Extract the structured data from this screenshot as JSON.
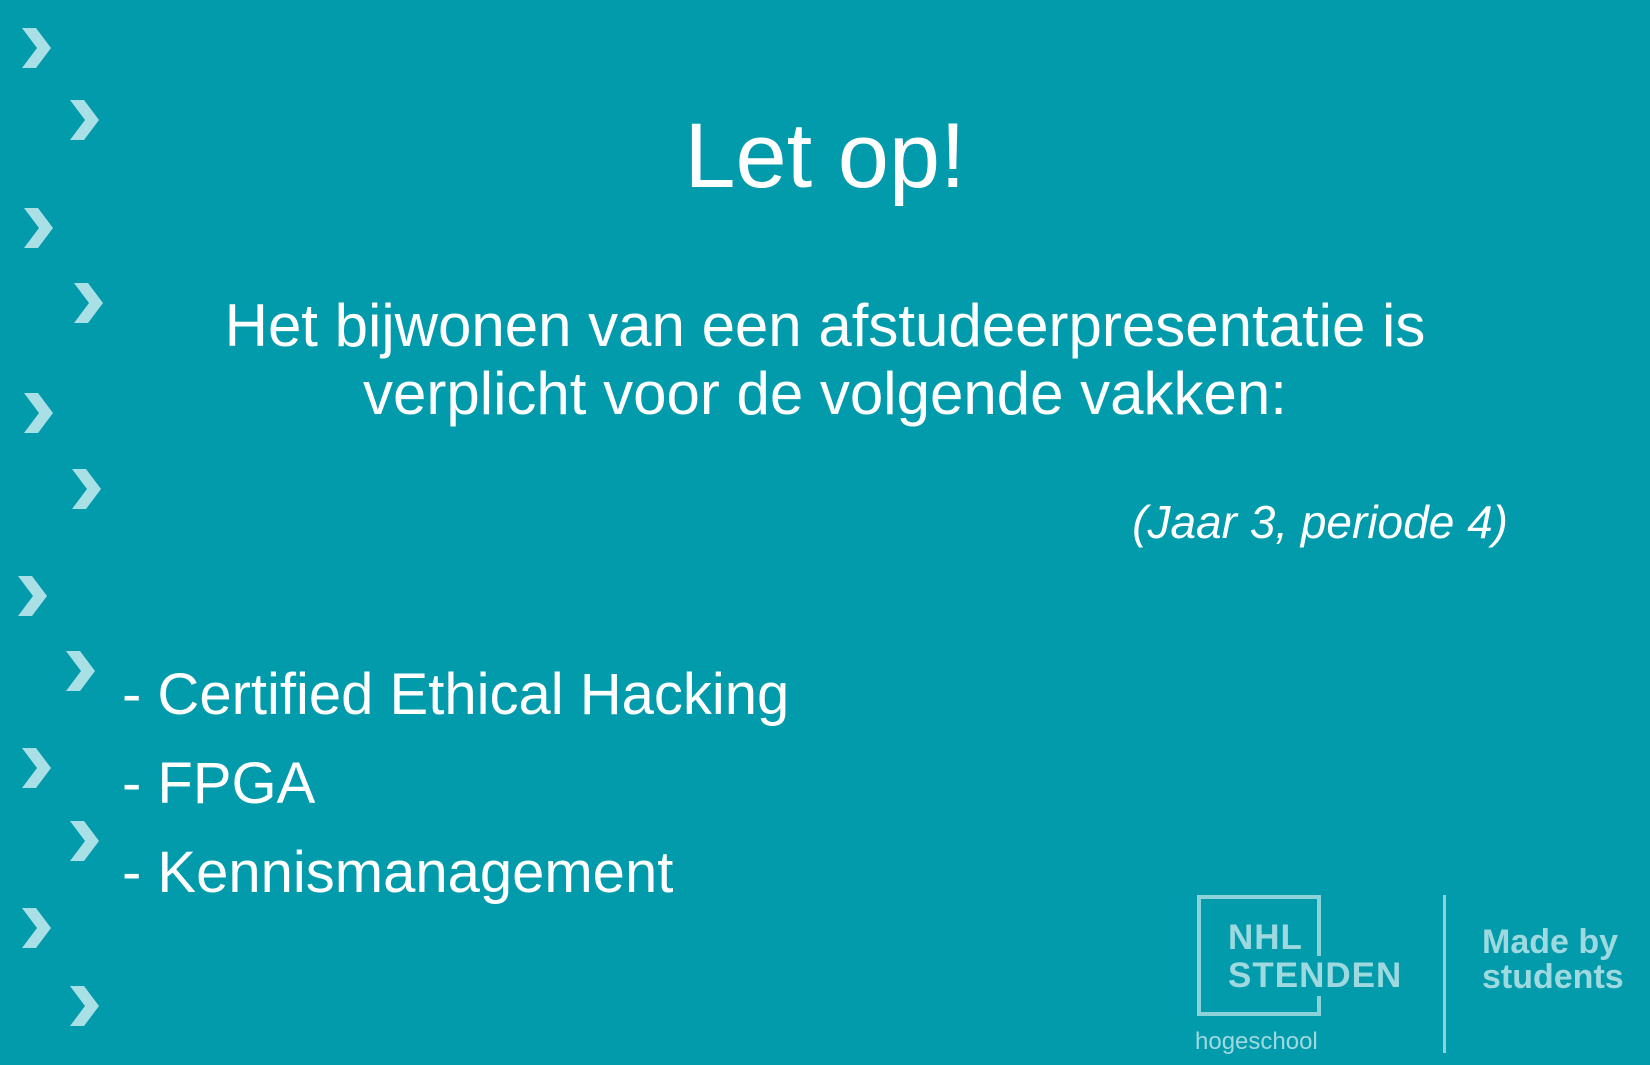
{
  "slide": {
    "title": "Let op!",
    "intro": "Het bijwonen van een afstudeerpresentatie is verplicht voor de volgende vakken:",
    "note": "(Jaar 3, periode 4)",
    "courses": [
      "- Certified Ethical Hacking",
      "- FPGA",
      "- Kennismanagement"
    ]
  },
  "logo": {
    "line1": "NHL",
    "line2": "STENDEN",
    "sub": "hogeschool",
    "tagline": "Made by students"
  },
  "colors": {
    "background": "#019bac",
    "text": "#ffffff",
    "chevron": "#a9e0e6"
  },
  "decor": {
    "chevron_icon": "chevron-right-icon"
  }
}
